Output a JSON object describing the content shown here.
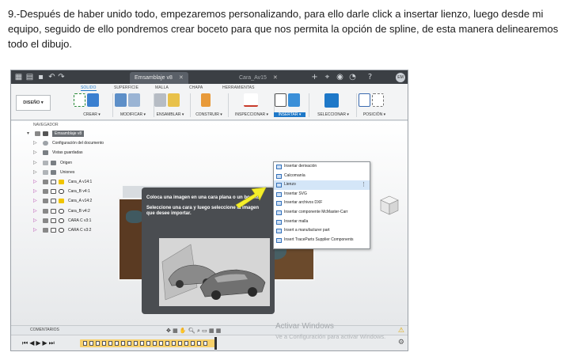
{
  "caption": "9.-Después de haber unido todo, empezaremos personalizando, para ello darle click a insertar lienzo, luego desde mi equipo, seguido de ello pondremos crear boceto para que nos permita la opción de spline, de esta manera delinearemos todo el dibujo.",
  "tabs": [
    {
      "label": "Emsamblaje v8",
      "active": true
    },
    {
      "label": "Cara_Av15",
      "active": false
    }
  ],
  "avatar": "EM",
  "ribbon": {
    "tabs": [
      "SOLIDO",
      "SUPERFICIE",
      "MALLA",
      "CHAPA",
      "HERRAMIENTAS"
    ],
    "active_tab": "SOLIDO",
    "design_button": "DISEÑO ▾",
    "groups": [
      "CREAR ▾",
      "MODIFICAR ▾",
      "ENSAMBLAR ▾",
      "CONSTRUIR ▾",
      "INSPECCIONAR ▾",
      "INSERTAR ▾",
      "SELECCIONAR ▾",
      "POSICIÓN ▾"
    ]
  },
  "browser": {
    "header": "NAVEGADOR",
    "root": "Emsamblaje v8",
    "items": [
      "Configuración del documento",
      "Vistas guardadas",
      "Origen",
      "Uniones",
      "Cara_A v14:1",
      "Cara_B v4:1",
      "Cara_A v14:2",
      "Cara_B v4:2",
      "CARA C v3:1",
      "CARA C v3:2"
    ]
  },
  "insert_menu": {
    "items": [
      "Insertar derivación",
      "Calcomanía",
      "Lienzo",
      "Insertar SVG",
      "Insertar archivos DXF",
      "Insertar componente McMaster-Carr",
      "Insertar malla",
      "Insert a manufacturer part",
      "Insert TraceParts Supplier Components"
    ],
    "highlighted": "Lienzo"
  },
  "tooltip": {
    "line1": "Coloca una imagen en una cara plana o un boceto.",
    "line2": "Seleccione una cara y luego seleccione la imagen que desee importar."
  },
  "bottom": {
    "comments": "COMENTARIOS",
    "watermark_title": "Activar Windows",
    "watermark_sub": "Ve a Configuración para activar Windows."
  },
  "colors": {
    "accent": "#1e78c8",
    "arrow": "#f4ee2a",
    "wood": "#5a3a22"
  }
}
